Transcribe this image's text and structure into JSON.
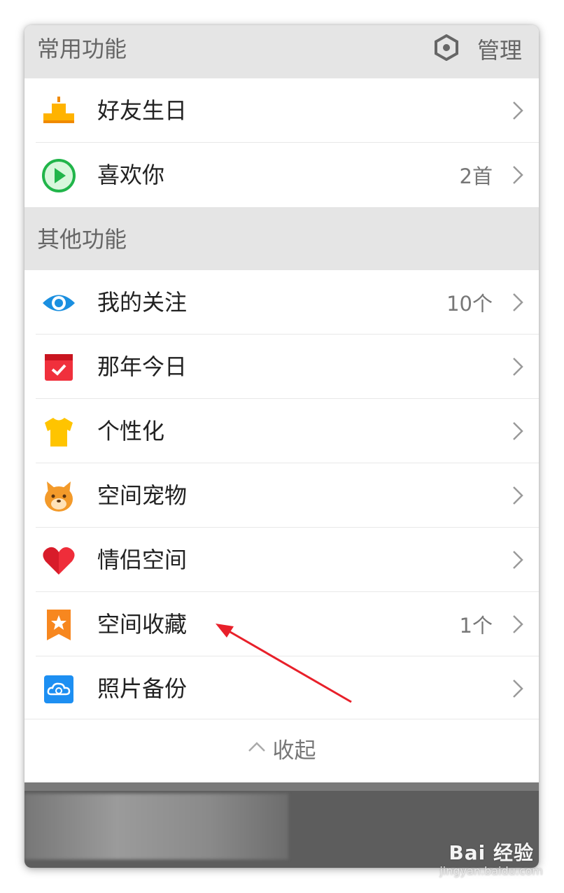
{
  "sections": {
    "common": {
      "title": "常用功能",
      "manage_label": "管理",
      "items": [
        {
          "label": "好友生日",
          "value": "",
          "icon": "cake-icon"
        },
        {
          "label": "喜欢你",
          "value": "2首",
          "icon": "play-icon"
        }
      ]
    },
    "other": {
      "title": "其他功能",
      "items": [
        {
          "label": "我的关注",
          "value": "10个",
          "icon": "eye-icon"
        },
        {
          "label": "那年今日",
          "value": "",
          "icon": "calendar-icon"
        },
        {
          "label": "个性化",
          "value": "",
          "icon": "tshirt-icon"
        },
        {
          "label": "空间宠物",
          "value": "",
          "icon": "pet-icon"
        },
        {
          "label": "情侣空间",
          "value": "",
          "icon": "heart-icon"
        },
        {
          "label": "空间收藏",
          "value": "1个",
          "icon": "bookmark-star-icon"
        },
        {
          "label": "照片备份",
          "value": "",
          "icon": "cloud-backup-icon"
        }
      ]
    }
  },
  "collapse": {
    "label": "收起",
    "icon": "chevron-up-icon"
  },
  "watermark": {
    "brand": "Bai 经验",
    "sub": "jingyan.baidu.com"
  },
  "colors": {
    "header_bg": "#e5e5e5",
    "arrow": "#e8202a",
    "strip": "#5d5d5d"
  }
}
